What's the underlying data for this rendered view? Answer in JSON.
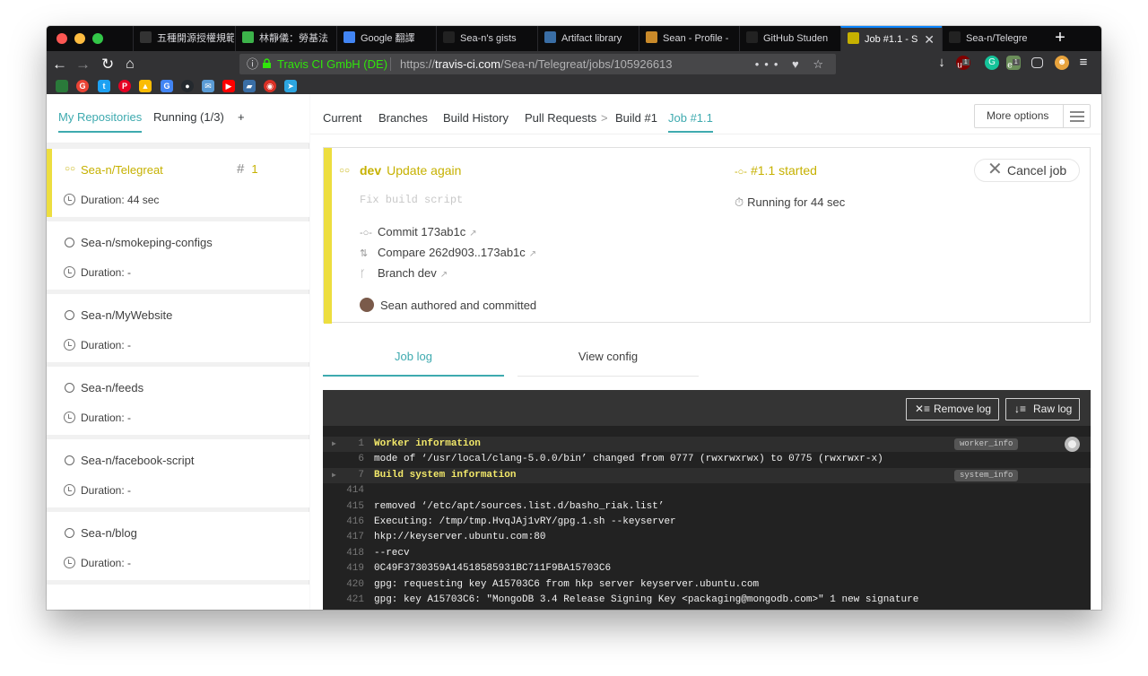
{
  "browser": {
    "tabs": [
      {
        "title": "五種開源授權規範",
        "favicon_color": "#333333"
      },
      {
        "title": "林靜儀：勞基法",
        "favicon_color": "#3cb34a"
      },
      {
        "title": "Google 翻譯",
        "favicon_color": "#4285f4"
      },
      {
        "title": "Sea-n's gists",
        "favicon_color": "#222222"
      },
      {
        "title": "Artifact library",
        "favicon_color": "#3a6ea5"
      },
      {
        "title": "Sean - Profile -",
        "favicon_color": "#c98a2a"
      },
      {
        "title": "GitHub Studen",
        "favicon_color": "#222222"
      },
      {
        "title": "Job #1.1 - S",
        "favicon_color": "#c6b100"
      },
      {
        "title": "Sea-n/Telegre",
        "favicon_color": "#222222"
      }
    ],
    "active_tab_index": 7,
    "new_tab_label": "+",
    "url": {
      "org": "Travis CI GmbH (DE)",
      "scheme": "https://",
      "host": "travis-ci.com",
      "path": "/Sea-n/Telegreat/jobs/105926613",
      "actions": "••• ♥ ☆"
    },
    "extension_badges": [
      "1",
      "1"
    ]
  },
  "sidebar": {
    "tabs": [
      {
        "label": "My Repositories",
        "active": true
      },
      {
        "label": "Running (1/3)",
        "active": false
      },
      {
        "label": "+",
        "active": false
      }
    ],
    "repos": [
      {
        "name": "Sea-n/Telegreat",
        "duration": "Duration: 44 sec",
        "active": true,
        "build_hash": "#",
        "build_number": "1"
      },
      {
        "name": "Sea-n/smokeping-configs",
        "duration": "Duration: -",
        "active": false
      },
      {
        "name": "Sea-n/MyWebsite",
        "duration": "Duration: -",
        "active": false
      },
      {
        "name": "Sea-n/feeds",
        "duration": "Duration: -",
        "active": false
      },
      {
        "name": "Sea-n/facebook-script",
        "duration": "Duration: -",
        "active": false
      },
      {
        "name": "Sea-n/blog",
        "duration": "Duration: -",
        "active": false
      }
    ]
  },
  "main": {
    "breadcrumbs": [
      "Current",
      "Branches",
      "Build History",
      "Pull Requests",
      ">",
      "Build #1",
      "Job #1.1"
    ],
    "more_options": "More options",
    "job": {
      "branch": "dev",
      "commit_message_title": "Update again",
      "commit_message_body": "Fix build script",
      "commit": "Commit 173ab1c",
      "compare": "Compare 262d903..173ab1c",
      "branch_link": "Branch dev",
      "author": "Sean authored and committed",
      "status": "#1.1 started",
      "running": "Running for 44 sec",
      "cancel": "Cancel job",
      "accent_color": "#edde3f"
    },
    "log_tabs": [
      "Job log",
      "View config"
    ],
    "log_buttons": {
      "remove": "Remove log",
      "raw": "Raw log"
    },
    "log_lines": [
      {
        "num": "1",
        "text": "Worker information",
        "fold": true,
        "tag": "worker_info"
      },
      {
        "num": "6",
        "text": "mode of ‘/usr/local/clang-5.0.0/bin’ changed from 0777 (rwxrwxrwx) to 0775 (rwxrwxr-x)",
        "fold": false
      },
      {
        "num": "7",
        "text": "Build system information",
        "fold": true,
        "tag": "system_info"
      },
      {
        "num": "414",
        "text": "",
        "fold": false
      },
      {
        "num": "415",
        "text": "removed ‘/etc/apt/sources.list.d/basho_riak.list’",
        "fold": false
      },
      {
        "num": "416",
        "text": "Executing: /tmp/tmp.HvqJAj1vRY/gpg.1.sh --keyserver",
        "fold": false
      },
      {
        "num": "417",
        "text": "hkp://keyserver.ubuntu.com:80",
        "fold": false
      },
      {
        "num": "418",
        "text": "--recv",
        "fold": false
      },
      {
        "num": "419",
        "text": "0C49F3730359A14518585931BC711F9BA15703C6",
        "fold": false
      },
      {
        "num": "420",
        "text": "gpg: requesting key A15703C6 from hkp server keyserver.ubuntu.com",
        "fold": false
      },
      {
        "num": "421",
        "text": "gpg: key A15703C6: \"MongoDB 3.4 Release Signing Key <packaging@mongodb.com>\" 1 new signature",
        "fold": false
      }
    ]
  }
}
